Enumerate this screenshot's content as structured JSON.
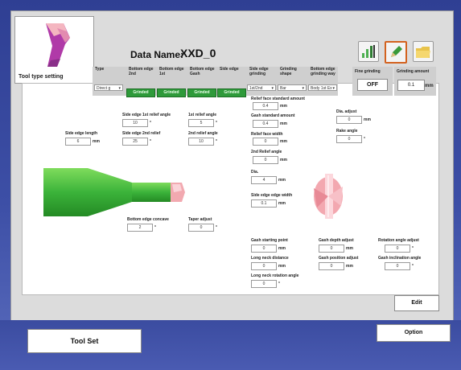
{
  "tool_card": {
    "label": "Tool type setting"
  },
  "header": {
    "data_name_label": "Data Name:",
    "data_name_value": "XXD_0"
  },
  "toolbar": {
    "icons": [
      "chart-icon",
      "edit-icon",
      "folder-icon"
    ]
  },
  "columns": {
    "type": {
      "label": "Type",
      "value": "Direct g"
    },
    "bottom2": {
      "label": "Bottom edge 2nd"
    },
    "bottom1": {
      "label": "Bottom edge 1st"
    },
    "bottom_gash": {
      "label": "Bottom edge Gash"
    },
    "side_edge": {
      "label": "Side edge"
    },
    "side_grinding": {
      "label": "Side edge grinding",
      "value": "1st/2nd"
    },
    "grinding_shape": {
      "label": "Grinding shape",
      "value": "Bar"
    },
    "bottom_way": {
      "label": "Bottom edge grinding way",
      "value": "Body 1st Ex"
    }
  },
  "grinded_buttons": [
    "Grinded",
    "Grinded",
    "Grinded",
    "Grinded"
  ],
  "fine_grinding": {
    "label": "Fine grinding",
    "value": "OFF"
  },
  "grinding_amount": {
    "label": "Grinding amount",
    "value": "0.1",
    "unit": "mm"
  },
  "fields": {
    "side_edge_length": {
      "label": "Side edge length",
      "value": "6",
      "unit": "mm"
    },
    "side_1st_relief": {
      "label": "Side edge 1st relief angle",
      "value": "10",
      "unit": "°"
    },
    "side_2nd_relief": {
      "label": "Side edge 2nd relief",
      "value": "25",
      "unit": "°"
    },
    "first_relief": {
      "label": "1st relief angle",
      "value": "5",
      "unit": "°"
    },
    "second_relief": {
      "label": "2nd relief angle",
      "value": "10",
      "unit": "°"
    },
    "relief_face_std": {
      "label": "Relief face standard amount",
      "value": "0.4",
      "unit": "mm"
    },
    "gash_std": {
      "label": "Gash standard amount",
      "value": "0.4",
      "unit": "mm"
    },
    "relief_face_width": {
      "label": "Relief face width",
      "value": "0",
      "unit": "mm"
    },
    "second_relief_angle": {
      "label": "2nd Relief angle",
      "value": "0",
      "unit": "mm"
    },
    "dia": {
      "label": "Dia.",
      "value": "4",
      "unit": "mm"
    },
    "side_edge_width": {
      "label": "Side edge edge width",
      "value": "0.1",
      "unit": "mm"
    },
    "dia_adjust": {
      "label": "Dia. adjust",
      "value": "0",
      "unit": "mm"
    },
    "rake_angle": {
      "label": "Rake angle",
      "value": "0",
      "unit": "°"
    },
    "bottom_concave": {
      "label": "Bottom edge concave",
      "value": "2",
      "unit": "°"
    },
    "taper_adjust": {
      "label": "Taper adjust",
      "value": "0",
      "unit": "°"
    },
    "gash_start": {
      "label": "Gash starting point",
      "value": "0",
      "unit": "mm"
    },
    "long_neck_distance": {
      "label": "Long neck distance",
      "value": "0",
      "unit": "mm"
    },
    "long_neck_rotation": {
      "label": "Long neck rotation angle",
      "value": "0",
      "unit": "°"
    },
    "gash_depth": {
      "label": "Gash depth adjust",
      "value": "0",
      "unit": "mm"
    },
    "gash_position": {
      "label": "Gash position adjust",
      "value": "0",
      "unit": "mm"
    },
    "rotation_angle": {
      "label": "Rotation angle adjust",
      "value": "0",
      "unit": "°"
    },
    "gash_inclination": {
      "label": "Gash inclination angle",
      "value": "0",
      "unit": "°"
    }
  },
  "buttons": {
    "edit": "Edit",
    "tool_set": "Tool Set",
    "option": "Option"
  },
  "colors": {
    "tool_green": "#38b53a",
    "tip_pink": "#f2a9b0",
    "accent_green": "#2e9a3a"
  }
}
